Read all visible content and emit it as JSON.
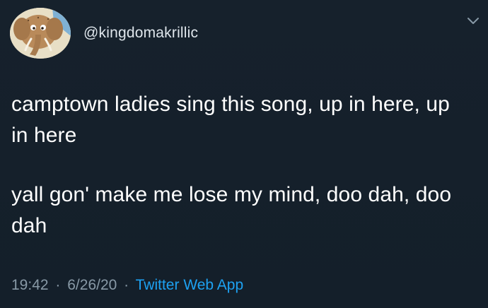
{
  "user": {
    "handle": "@kingdomakrillic",
    "avatar_icon": "elephant-cartoon-avatar"
  },
  "tweet": {
    "paragraphs": [
      "camptown ladies sing this song, up in here, up in here",
      "yall gon' make me lose my mind, doo dah, doo dah"
    ],
    "time": "19:42",
    "date": "6/26/20",
    "separator": "·",
    "source": "Twitter Web App"
  },
  "icons": {
    "menu": "chevron-down-icon"
  },
  "colors": {
    "background": "#15202b",
    "text": "#ffffff",
    "secondary_text": "#8899a6",
    "link": "#1da1f2"
  }
}
